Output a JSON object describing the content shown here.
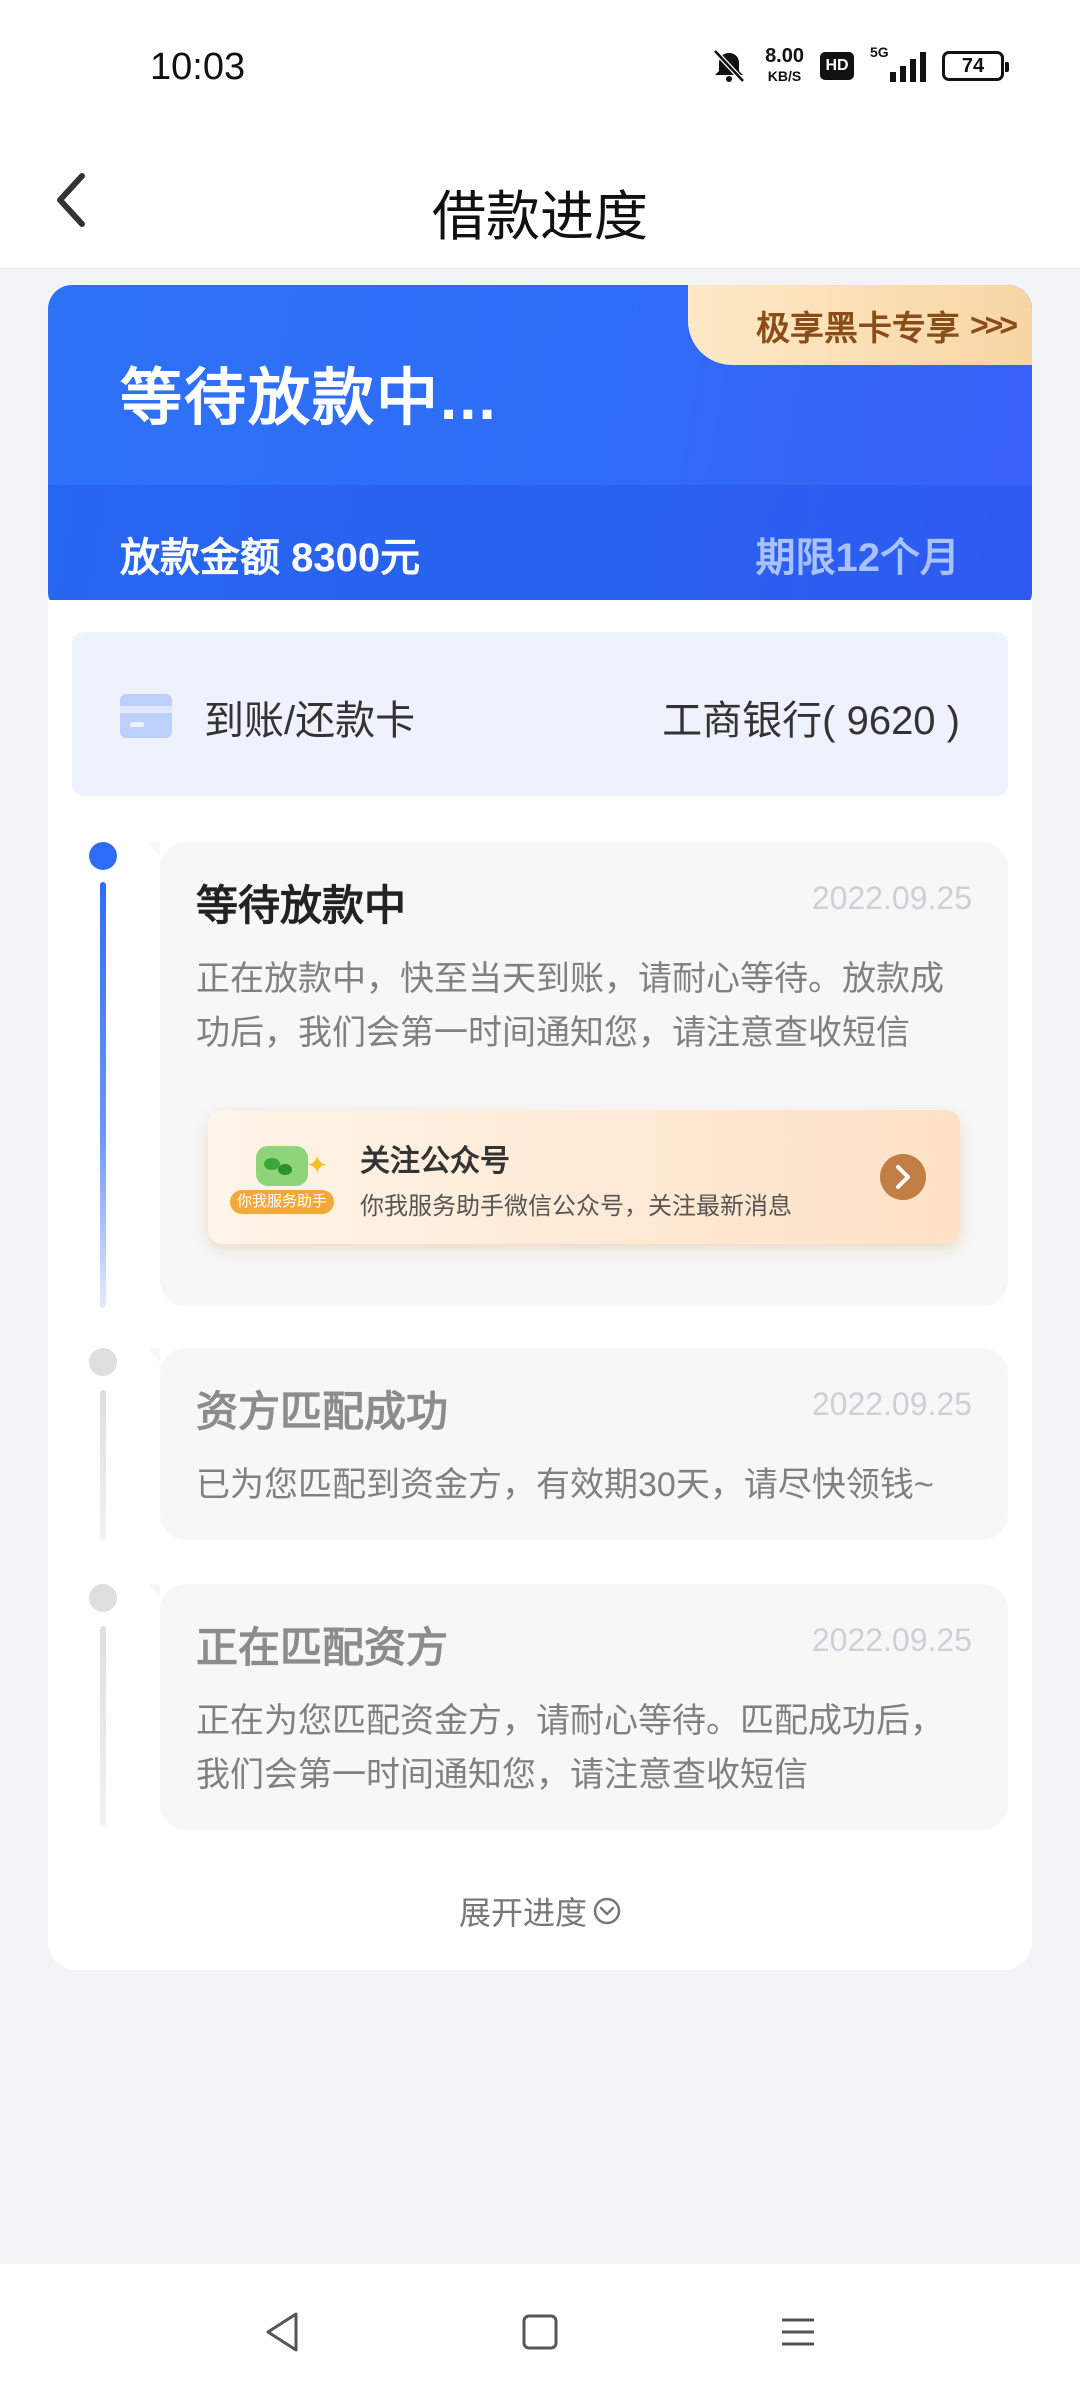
{
  "status_bar": {
    "time": "10:03",
    "net_speed": "8.00",
    "net_unit": "KB/S",
    "hd": "HD",
    "network": "5G",
    "battery": "74"
  },
  "header": {
    "title": "借款进度"
  },
  "hero": {
    "status": "等待放款中...",
    "badge": "极享黑卡专享",
    "badge_arrows": ">>>",
    "amount": "放款金额 8300元",
    "term": "期限12个月"
  },
  "bank_card": {
    "label": "到账/还款卡",
    "bank": "工商银行( 9620 )"
  },
  "steps": [
    {
      "title": "等待放款中",
      "date": "2022.09.25",
      "desc": "正在放款中，快至当天到账，请耐心等待。放款成功后，我们会第一时间通知您，请注意查收短信",
      "active": true
    },
    {
      "title": "资方匹配成功",
      "date": "2022.09.25",
      "desc": "已为您匹配到资金方，有效期30天，请尽快领钱~",
      "active": false
    },
    {
      "title": "正在匹配资方",
      "date": "2022.09.25",
      "desc": "正在为您匹配资金方，请耐心等待。匹配成功后，我们会第一时间通知您，请注意查收短信",
      "active": false
    }
  ],
  "wechat_promo": {
    "logo_tag": "你我服务助手",
    "title": "关注公众号",
    "subtitle": "你我服务助手微信公众号，关注最新消息"
  },
  "expand_label": "展开进度",
  "colors": {
    "primary": "#2f6cf5",
    "badge_text": "#8a4d1a",
    "inactive": "#d8d8d8"
  }
}
